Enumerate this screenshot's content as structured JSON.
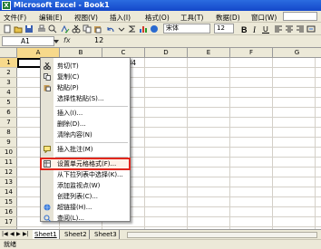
{
  "window": {
    "title": "Microsoft Excel - Book1"
  },
  "menubar": {
    "items": [
      "文件(F)",
      "编辑(E)",
      "视图(V)",
      "插入(I)",
      "格式(O)",
      "工具(T)",
      "数据(D)",
      "窗口(W)"
    ]
  },
  "toolbar": {
    "font_name": "宋体",
    "font_size": "12"
  },
  "formula_bar": {
    "name_box": "A1",
    "fx": "fx",
    "value": "12"
  },
  "grid": {
    "columns": [
      "A",
      "B",
      "C",
      "D",
      "E",
      "F",
      "G"
    ],
    "rows": [
      "1",
      "2",
      "3",
      "4",
      "5",
      "6",
      "7",
      "8",
      "9",
      "10",
      "11",
      "12",
      "13",
      "14",
      "15",
      "16",
      "17"
    ],
    "row1_values": [
      "12",
      "34"
    ]
  },
  "context_menu": {
    "items": [
      "剪切(T)",
      "复制(C)",
      "粘贴(P)",
      "选择性粘贴(S)...",
      "插入(I)...",
      "删除(D)...",
      "清除内容(N)",
      "插入批注(M)",
      "设置单元格格式(F)...",
      "从下拉列表中选择(K)...",
      "添加监视点(W)",
      "创建列表(C)...",
      "超链接(H)...",
      "查阅(L)..."
    ]
  },
  "sheet_tabs": [
    "Sheet1",
    "Sheet2",
    "Sheet3"
  ],
  "status": {
    "text": "就绪"
  },
  "colors": {
    "title_bar": "#1447c9",
    "highlight_border": "#e1261c",
    "chrome": "#ece9d8"
  }
}
